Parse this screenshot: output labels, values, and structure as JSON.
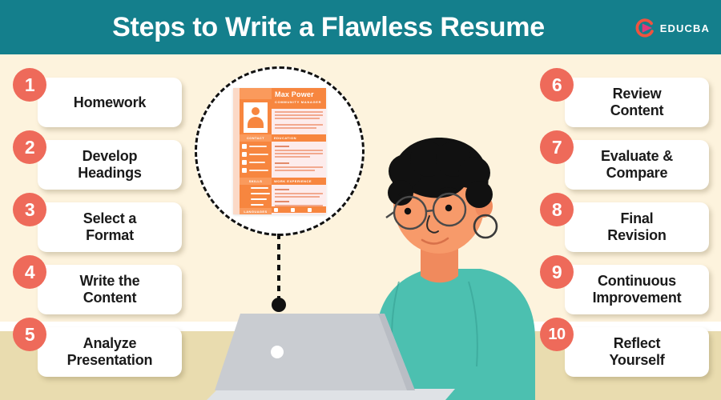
{
  "header": {
    "title": "Steps to Write a Flawless Resume",
    "background_color": "#147f8c",
    "title_color": "#ffffff",
    "logo_text": "EDUCBA",
    "logo_icon": "educba-circle-play-logo"
  },
  "theme": {
    "wall_color": "#fdf3dd",
    "floor_color": "#e9dcaf",
    "baseboard_color": "#ffffff",
    "badge_color": "#ee6a5a",
    "card_color": "#ffffff",
    "text_color": "#1a1a1a",
    "accent_orange": "#f7863f",
    "shirt_teal": "#45bdae",
    "skin": "#f79a6a",
    "hair": "#111111",
    "laptop_gray": "#c9ccd1"
  },
  "steps_left": [
    {
      "number": "1",
      "label": "Homework"
    },
    {
      "number": "2",
      "label": "Develop\nHeadings"
    },
    {
      "number": "3",
      "label": "Select a\nFormat"
    },
    {
      "number": "4",
      "label": "Write the\nContent"
    },
    {
      "number": "5",
      "label": "Analyze\nPresentation"
    }
  ],
  "steps_right": [
    {
      "number": "6",
      "label": "Review\nContent"
    },
    {
      "number": "7",
      "label": "Evaluate &\nCompare"
    },
    {
      "number": "8",
      "label": "Final\nRevision"
    },
    {
      "number": "9",
      "label": "Continuous\nImprovement"
    },
    {
      "number": "10",
      "label": "Reflect\nYourself"
    }
  ],
  "resume_preview": {
    "name": "Max Power",
    "role": "COMMUNITY MANAGER",
    "sections_left": [
      "CONTACT",
      "SKILLS",
      "LANGUAGES"
    ],
    "sections_right": [
      "EDUCATION",
      "WORK EXPERIENCE"
    ],
    "circle_border_style": "dashed",
    "connector": "dashed-line-with-dot"
  },
  "illustration": {
    "subject": "person-typing-on-laptop",
    "features": [
      "curly-black-hair",
      "round-glasses",
      "hoop-earrings",
      "teal-v-neck-top"
    ],
    "device": "laptop"
  }
}
